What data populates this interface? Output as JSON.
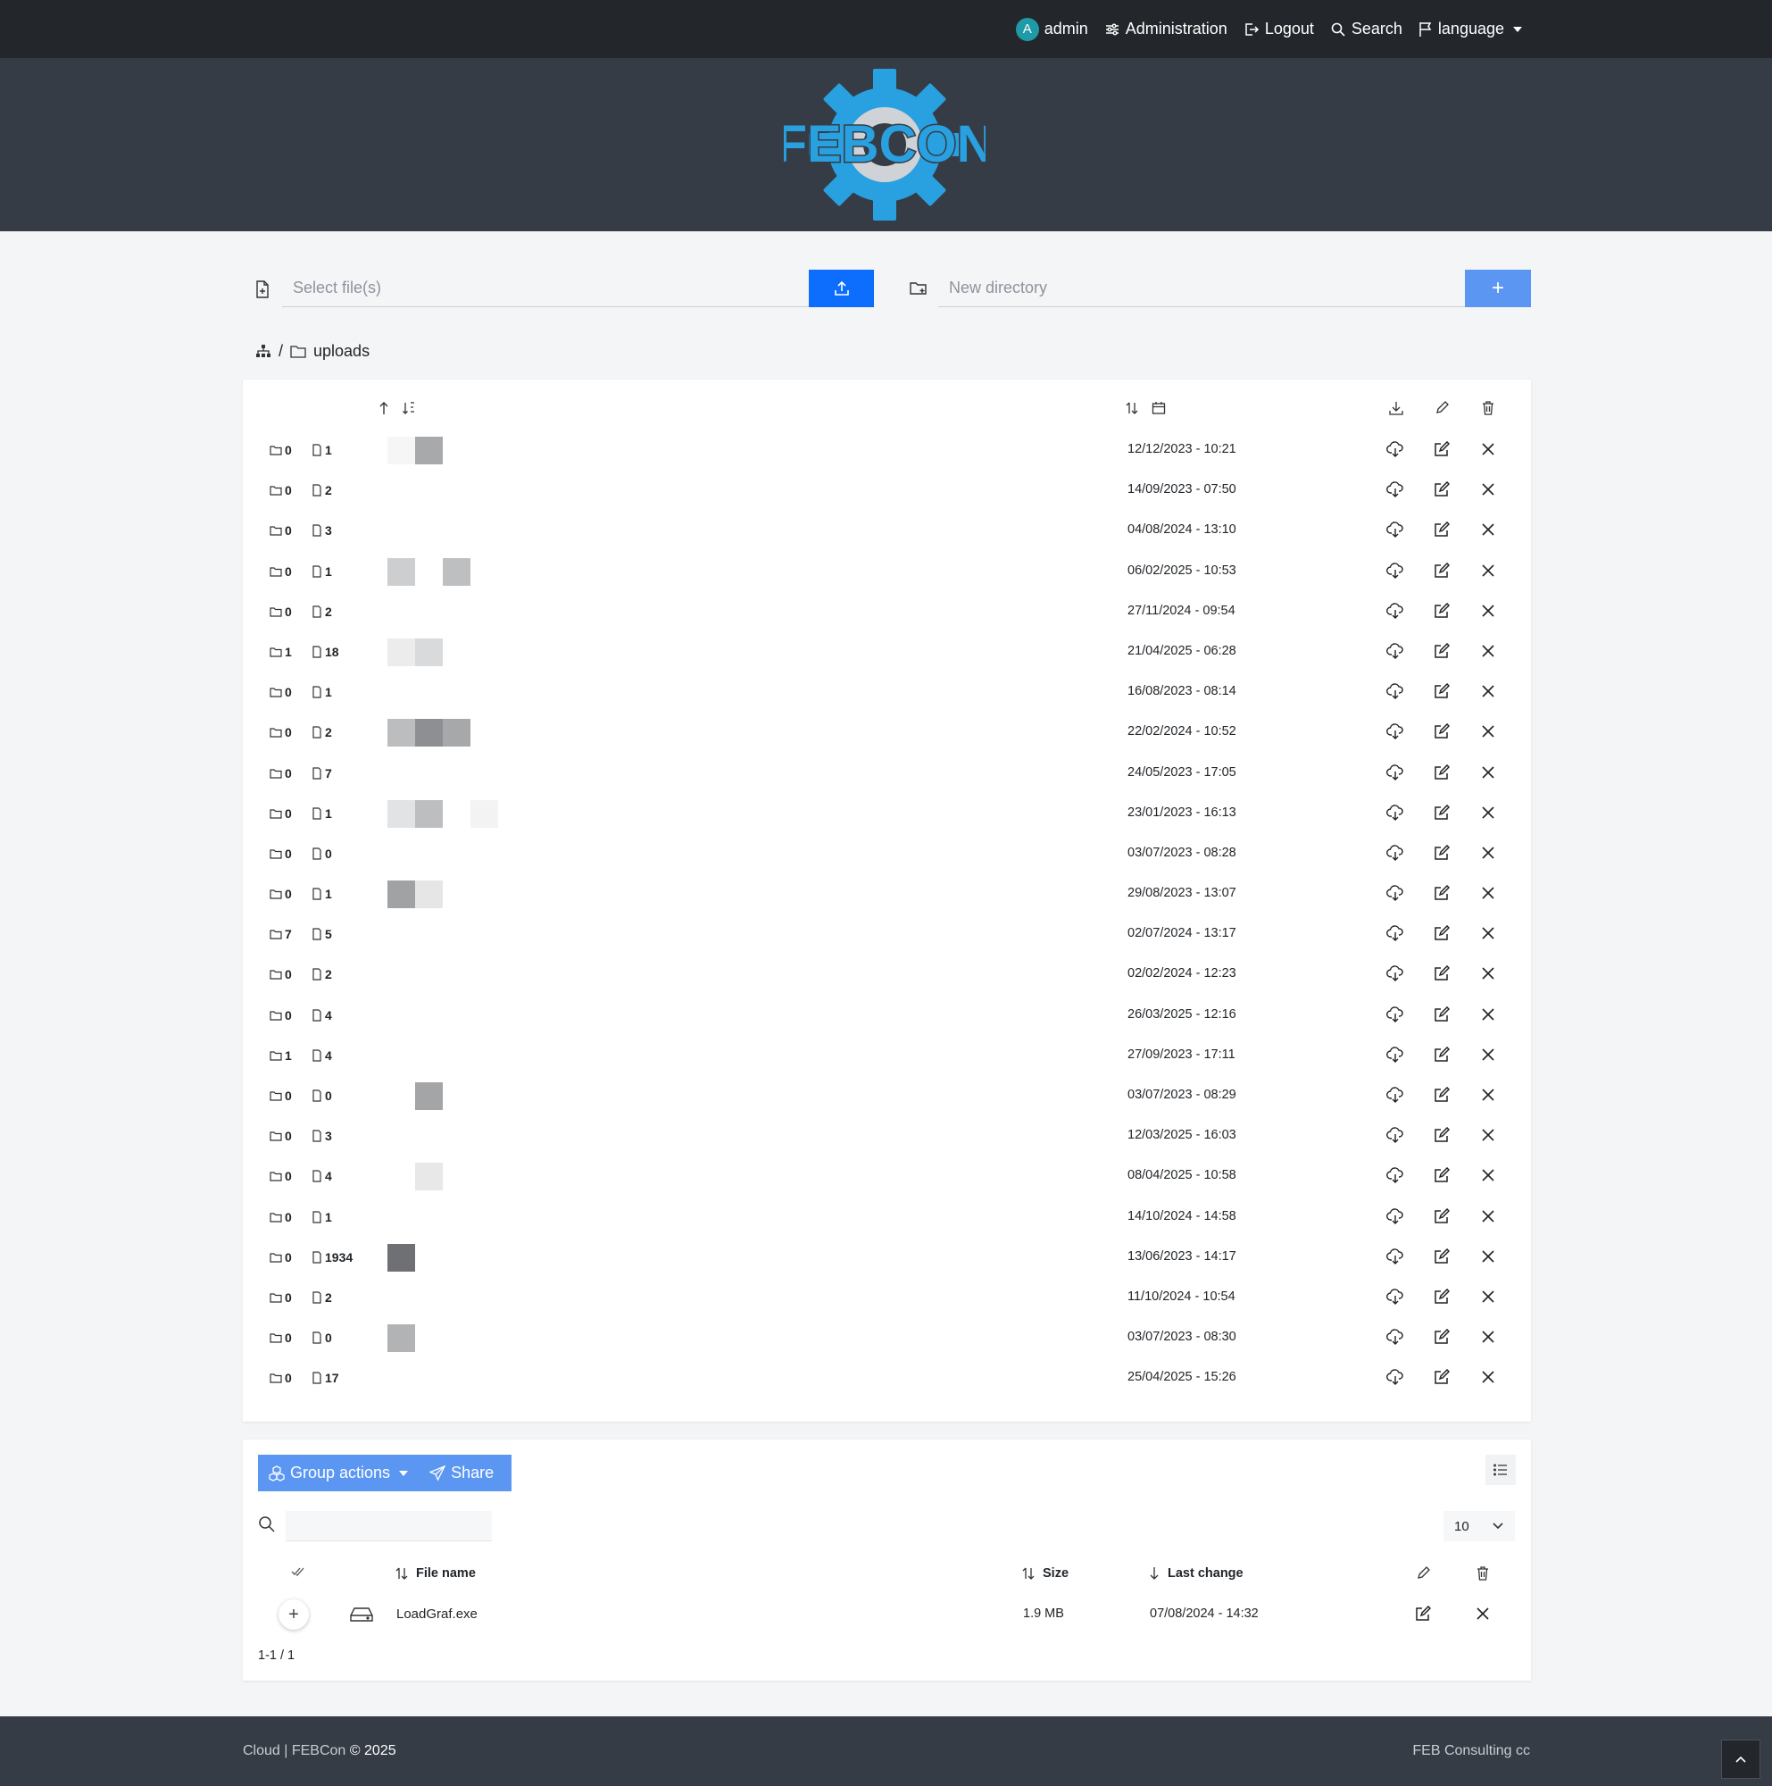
{
  "nav": {
    "avatar_letter": "A",
    "user": "admin",
    "administration": "Administration",
    "logout": "Logout",
    "search": "Search",
    "language": "language"
  },
  "logo": {
    "text": "FEBCON",
    "color": "#29a0e0"
  },
  "upload": {
    "file_placeholder": "Select file(s)",
    "dir_placeholder": "New directory",
    "add_label": "+"
  },
  "breadcrumb": {
    "separator": "/",
    "current": "uploads"
  },
  "directories": [
    {
      "folders": "0",
      "files": "1",
      "date": "12/12/2023 - 10:21",
      "thumbs": [
        "#f6f6f7",
        "#a8a9ab"
      ]
    },
    {
      "folders": "0",
      "files": "2",
      "date": "14/09/2023 - 07:50",
      "thumbs": []
    },
    {
      "folders": "0",
      "files": "3",
      "date": "04/08/2024 - 13:10",
      "thumbs": []
    },
    {
      "folders": "0",
      "files": "1",
      "date": "06/02/2025 - 10:53",
      "thumbs": [
        "#cdcecf",
        "#ffffff",
        "#bebfc1"
      ]
    },
    {
      "folders": "0",
      "files": "2",
      "date": "27/11/2024 - 09:54",
      "thumbs": []
    },
    {
      "folders": "1",
      "files": "18",
      "date": "21/04/2025 - 06:28",
      "thumbs": [
        "#ececed",
        "#d9dadb"
      ]
    },
    {
      "folders": "0",
      "files": "1",
      "date": "16/08/2023 - 08:14",
      "thumbs": []
    },
    {
      "folders": "0",
      "files": "2",
      "date": "22/02/2024 - 10:52",
      "thumbs": [
        "#bcbdbe",
        "#8e8f92",
        "#a7a8aa"
      ]
    },
    {
      "folders": "0",
      "files": "7",
      "date": "24/05/2023 - 17:05",
      "thumbs": []
    },
    {
      "folders": "0",
      "files": "1",
      "date": "23/01/2023 - 16:13",
      "thumbs": [
        "#e2e3e4",
        "#bdbec0",
        "#ffffff",
        "#f3f3f4"
      ]
    },
    {
      "folders": "0",
      "files": "0",
      "date": "03/07/2023 - 08:28",
      "thumbs": []
    },
    {
      "folders": "0",
      "files": "1",
      "date": "29/08/2023 - 13:07",
      "thumbs": [
        "#a1a2a4",
        "#e6e6e7"
      ]
    },
    {
      "folders": "7",
      "files": "5",
      "date": "02/07/2024 - 13:17",
      "thumbs": []
    },
    {
      "folders": "0",
      "files": "2",
      "date": "02/02/2024 - 12:23",
      "thumbs": []
    },
    {
      "folders": "0",
      "files": "4",
      "date": "26/03/2025 - 12:16",
      "thumbs": []
    },
    {
      "folders": "1",
      "files": "4",
      "date": "27/09/2023 - 17:11",
      "thumbs": []
    },
    {
      "folders": "0",
      "files": "0",
      "date": "03/07/2023 - 08:29",
      "thumbs": [
        "#ffffff",
        "#a4a5a7"
      ]
    },
    {
      "folders": "0",
      "files": "3",
      "date": "12/03/2025 - 16:03",
      "thumbs": []
    },
    {
      "folders": "0",
      "files": "4",
      "date": "08/04/2025 - 10:58",
      "thumbs": [
        "#ffffff",
        "#e8e8e9"
      ]
    },
    {
      "folders": "0",
      "files": "1",
      "date": "14/10/2024 - 14:58",
      "thumbs": []
    },
    {
      "folders": "0",
      "files": "1934",
      "date": "13/06/2023 - 14:17",
      "thumbs": [
        "#6e7074"
      ]
    },
    {
      "folders": "0",
      "files": "2",
      "date": "11/10/2024 - 10:54",
      "thumbs": []
    },
    {
      "folders": "0",
      "files": "0",
      "date": "03/07/2023 - 08:30",
      "thumbs": [
        "#b2b3b5"
      ]
    },
    {
      "folders": "0",
      "files": "17",
      "date": "25/04/2025 - 15:26",
      "thumbs": []
    }
  ],
  "files": {
    "group_actions": "Group actions",
    "share": "Share",
    "per_page": "10",
    "headers": {
      "name": "File name",
      "size": "Size",
      "changed": "Last change"
    },
    "rows": [
      {
        "name": "LoadGraf.exe",
        "size": "1.9 MB",
        "changed": "07/08/2024 - 14:32"
      }
    ],
    "pager": "1-1 / 1"
  },
  "footer": {
    "left_prefix": "Cloud | FEBCon",
    "left_suffix": "© 2025",
    "right": "FEB Consulting cc"
  }
}
